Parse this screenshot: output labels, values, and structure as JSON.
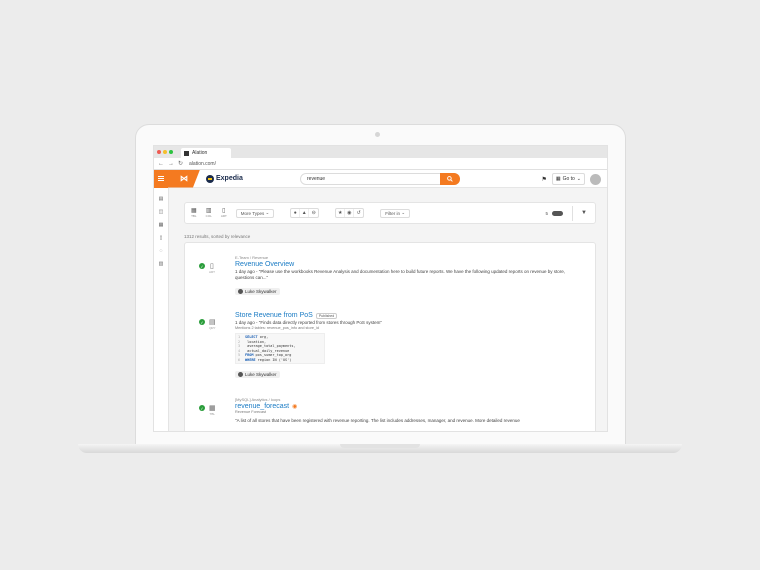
{
  "browser": {
    "tab_title": "Alation",
    "url": "alation.com/"
  },
  "header": {
    "brand": "Expedia",
    "search_value": "revenue",
    "goto_label": "Go to"
  },
  "filters": {
    "types": [
      {
        "icon": "table-icon",
        "label": "TBL"
      },
      {
        "icon": "column-icon",
        "label": "COL"
      },
      {
        "icon": "article-icon",
        "label": "ART"
      }
    ],
    "more_types": "More Types",
    "filter_in": "Filter in",
    "slider_value": "5"
  },
  "results_count": "1312 results, sorted by relevance",
  "results": [
    {
      "type_label": "ART",
      "crumb": "E-Team  /  Revenue",
      "title": "Revenue Overview",
      "meta": "1 day ago - \"Please use the workbooks Revenue Analysis and documentation here to build future reports. We have the following updated reports on revenue by store, questions can...\"",
      "user": "Luke Skywalker"
    },
    {
      "type_label": "QRY",
      "title": "Store Revenue from PoS",
      "badge": "Published",
      "meta": "1 day ago - \"Finds data directly reported from stores through PoS system\"",
      "mentions": "Mentions 2 tables:  revenue_pos_info and  store_id",
      "code": [
        {
          "n": "1",
          "kw": "SELECT",
          "t": " org,"
        },
        {
          "n": "2",
          "kw": "",
          "t": "      location,"
        },
        {
          "n": "3",
          "kw": "",
          "t": "      average_total_payments,"
        },
        {
          "n": "4",
          "kw": "",
          "t": "      actual_daily_revenue"
        },
        {
          "n": "5",
          "kw": "FROM",
          "t": " pos_sumer_top_org"
        },
        {
          "n": "6",
          "kw": "WHERE",
          "t": " region IN ('US')"
        }
      ],
      "user": "Luke Skywalker"
    },
    {
      "type_label": "TBL",
      "crumb": "[MySQL] Analytics  /  loops",
      "title": "revenue_forecast",
      "subtitle": "Revenue Forecast",
      "meta": "\"A list of all stores that have been registered with revenue reporting. The list includes addresses, manager, and revenue. More detailed revenue"
    }
  ]
}
